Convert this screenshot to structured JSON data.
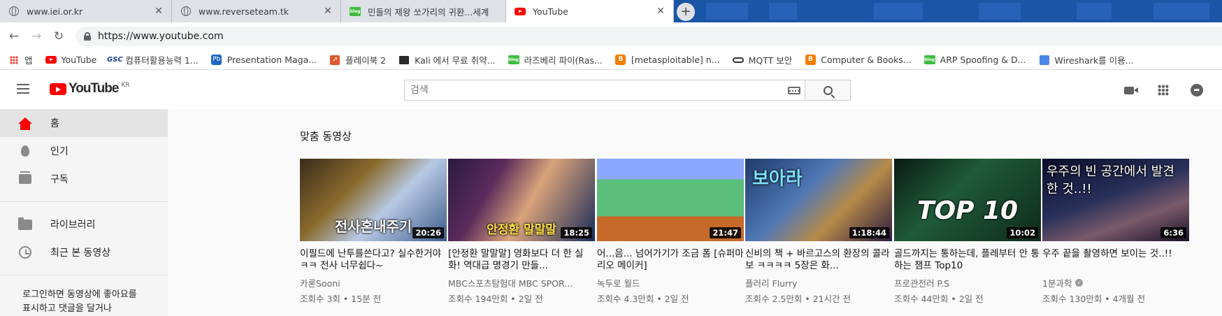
{
  "browser": {
    "tabs": [
      {
        "title": "www.iei.or.kr",
        "favicon": "globe-icon",
        "active": false
      },
      {
        "title": "www.reverseteam.tk",
        "favicon": "globe-icon",
        "active": false
      },
      {
        "title": "민들의 제왕 쏘가리의 귀환...세계",
        "favicon": "blog-icon",
        "active": false
      },
      {
        "title": "YouTube",
        "favicon": "youtube-icon",
        "active": true
      }
    ],
    "new_tab_label": "+",
    "close_label": "✕",
    "url": "https://www.youtube.com",
    "bookmarks": [
      {
        "label": "앱",
        "icon": "apps-icon"
      },
      {
        "label": "YouTube",
        "icon": "youtube-icon"
      },
      {
        "label": "컴퓨터활용능력 1...",
        "icon": "gsc-icon"
      },
      {
        "label": "Presentation Maga...",
        "icon": "pb-icon"
      },
      {
        "label": "플레이북 2",
        "icon": "playbook-icon"
      },
      {
        "label": "Kali 에서 무료 취약...",
        "icon": "kali-icon"
      },
      {
        "label": "라즈베리 파이(Ras...",
        "icon": "blog-icon"
      },
      {
        "label": "[metasploitable] n...",
        "icon": "blogger-icon"
      },
      {
        "label": "MQTT 보안",
        "icon": "mqtt-icon"
      },
      {
        "label": "Computer & Books...",
        "icon": "blogger-icon"
      },
      {
        "label": "ARP Spoofing & D...",
        "icon": "blog-icon"
      },
      {
        "label": "Wireshark를 이용...",
        "icon": "wireshark-icon"
      }
    ]
  },
  "youtube": {
    "logo_text": "YouTube",
    "country_code": "KR",
    "search_placeholder": "검색",
    "brand_color": "#ff0000",
    "sidebar": {
      "items": [
        {
          "label": "홈",
          "icon": "home-icon",
          "active": true
        },
        {
          "label": "인기",
          "icon": "trending-icon",
          "active": false
        },
        {
          "label": "구독",
          "icon": "subscriptions-icon",
          "active": false
        }
      ],
      "items2": [
        {
          "label": "라이브러리",
          "icon": "library-icon"
        },
        {
          "label": "최근 본 동영상",
          "icon": "history-icon"
        }
      ],
      "login_note": "로그인하면 동영상에 좋아요를 표시하고 댓글을 달거나"
    },
    "section_title": "맞춤 동영상",
    "videos": [
      {
        "title": "이필드에 난투를쓴다고? 실수한거야ㅋㅋ 전사 너무쉽다~",
        "channel": "카론Sooni",
        "meta": "조회수 3회 • 15분 전",
        "duration": "20:26",
        "thumb_text": "전사혼내주기",
        "verified": false
      },
      {
        "title": "[안정환 말말말] 영화보다 더 한 실화! 역대급 명경기 만들...",
        "channel": "MBC스포츠탐험대 MBC SPOR...",
        "meta": "조회수 194만회 • 2일 전",
        "duration": "18:25",
        "thumb_text": "안정환 말말말",
        "verified": false
      },
      {
        "title": "어...음... 넘어가기가 조금 폼 [슈퍼마리오 메이커]",
        "channel": "녹두로 월드",
        "meta": "조회수 4.3만회 • 2일 전",
        "duration": "21:47",
        "thumb_text": "",
        "verified": false
      },
      {
        "title": "신비의 책 + 바르고스의 환장의 콜라보 ㅋㅋㅋㅋ 5장은 화...",
        "channel": "플러리 Flurry",
        "meta": "조회수 2.5만회 • 21시간 전",
        "duration": "1:18:44",
        "thumb_text": "보아라",
        "verified": false
      },
      {
        "title": "골드까지는 통하는데, 플레부터 안 통하는 챔프 Top10",
        "channel": "프로관전러 P.S",
        "meta": "조회수 44만회 • 2일 전",
        "duration": "10:02",
        "thumb_text": "TOP 10",
        "verified": false
      },
      {
        "title": "우주 끝을 촬영하면 보이는 것..!!",
        "channel": "1분과학",
        "meta": "조회수 130만회 • 4개월 전",
        "duration": "6:36",
        "thumb_text": "우주의 빈 공간에서 발견한 것..!!",
        "verified": true
      }
    ]
  }
}
